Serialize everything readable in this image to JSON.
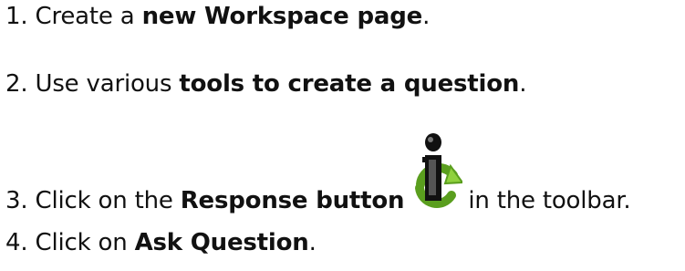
{
  "steps": [
    {
      "number": "1.",
      "before": "Create a",
      "bold": "new Workspace page",
      "after": "."
    },
    {
      "number": "2.",
      "before": "Use various",
      "bold": "tools to create a question",
      "after": "."
    },
    {
      "number": "3.",
      "before": "Click on the",
      "bold": "Response button",
      "after": "in the toolbar."
    },
    {
      "number": "4.",
      "before": "Click on",
      "bold": "Ask Question",
      "after": "."
    }
  ],
  "icons": {
    "response": "response-info-icon"
  },
  "colors": {
    "icon_green": "#5a9e1e",
    "icon_green_light": "#8fd13d",
    "icon_black": "#111111"
  }
}
